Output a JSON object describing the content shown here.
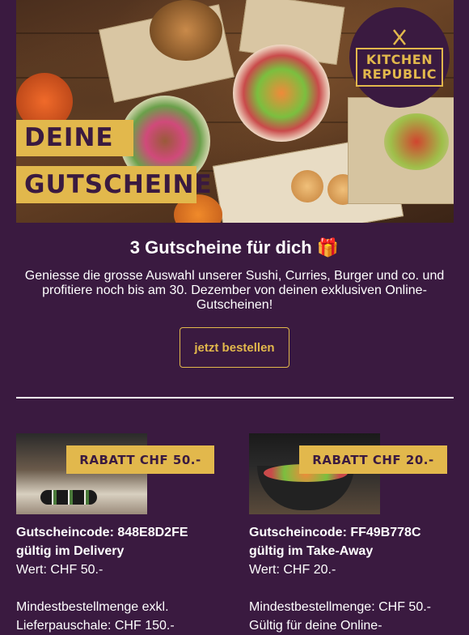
{
  "hero": {
    "label_line1": "DEINE",
    "label_line2": "GUTSCHEINE",
    "logo_line1": "KITCHEN",
    "logo_line2": "REPUBLIC"
  },
  "headline": "3 Gutscheine für dich 🎁",
  "intro": "Geniesse die grosse Auswahl unserer Sushi, Curries, Burger und co. und profitiere noch bis am 30. Dezember von deinen exklusiven Online-Gutscheinen!",
  "cta_label": "jetzt bestellen",
  "colors": {
    "background": "#3a1a40",
    "accent": "#e2b84c",
    "text": "#ffffff"
  },
  "vouchers": [
    {
      "badge": "RABATT CHF 50.-",
      "code_line": "Gutscheincode: 848E8D2FE",
      "validity": "gültig im Delivery",
      "value": "Wert: CHF 50.-",
      "min_line1": "Mindestbestellmenge exkl.",
      "min_line2": "Lieferpauschale: CHF 150.-"
    },
    {
      "badge": "RABATT CHF 20.-",
      "code_line": "Gutscheincode: FF49B778C",
      "validity": "gültig im Take-Away",
      "value": "Wert: CHF 20.-",
      "min_line1": "Mindestbestellmenge: CHF 50.-",
      "min_line2": "Gültig für deine Online-"
    }
  ]
}
